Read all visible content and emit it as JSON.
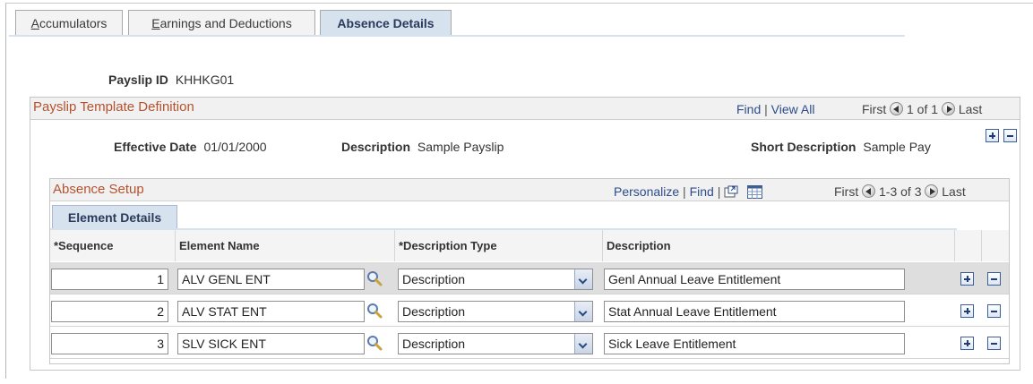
{
  "tabs": [
    {
      "label": "Accumulators",
      "underline": "A",
      "rest": "ccumulators"
    },
    {
      "label": "Earnings and Deductions",
      "underline": "E",
      "rest": "arnings and Deductions"
    },
    {
      "label": "Absence Details"
    }
  ],
  "payslip": {
    "label": "Payslip ID",
    "value": "KHHKG01"
  },
  "template": {
    "title": "Payslip Template Definition",
    "find": "Find",
    "view_all": "View All",
    "first": "First",
    "range": "1 of 1",
    "last": "Last",
    "effective_date_label": "Effective Date",
    "effective_date": "01/01/2000",
    "description_label": "Description",
    "description": "Sample Payslip",
    "short_description_label": "Short Description",
    "short_description": "Sample Pay"
  },
  "absence": {
    "title": "Absence Setup",
    "personalize": "Personalize",
    "find": "Find",
    "first": "First",
    "range": "1-3 of 3",
    "last": "Last",
    "tab": "Element Details",
    "columns": {
      "sequence": "*Sequence",
      "element_name": "Element Name",
      "description_type": "*Description Type",
      "description": "Description"
    },
    "rows": [
      {
        "sequence": "1",
        "element_name": "ALV GENL ENT",
        "description_type": "Description",
        "description": "Genl Annual Leave Entitlement"
      },
      {
        "sequence": "2",
        "element_name": "ALV STAT ENT",
        "description_type": "Description",
        "description": "Stat Annual Leave Entitlement"
      },
      {
        "sequence": "3",
        "element_name": "SLV SICK ENT",
        "description_type": "Description",
        "description": "Sick Leave Entitlement"
      }
    ]
  },
  "icons": {
    "add": "plus-icon",
    "delete": "minus-icon",
    "prompt": "magnifier-icon",
    "dropdown": "chevron-down-icon",
    "zoom": "zoom-grid-icon",
    "download": "spreadsheet-icon",
    "previous": "previous-arrow-icon",
    "next": "next-arrow-icon"
  },
  "colors": {
    "accent_title": "#b5532f",
    "link": "#2c4c8c",
    "tab_active": "#d7e2ef"
  }
}
